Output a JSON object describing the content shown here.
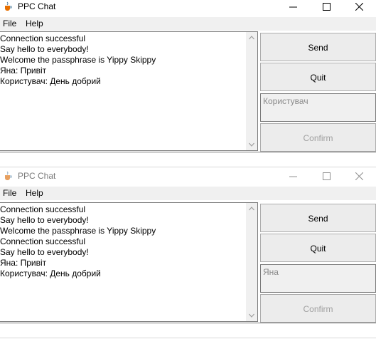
{
  "windows": [
    {
      "title": "PPC Chat",
      "menu": [
        "File",
        "Help"
      ],
      "messages": [
        "Connection successful",
        "Say hello to everybody!",
        "Welcome the passphrase is Yippy Skippy",
        "Яна: Привіт",
        "Користувач: День добрий"
      ],
      "send_label": "Send",
      "quit_label": "Quit",
      "name_value": "Користувач",
      "confirm_label": "Confirm"
    },
    {
      "title": "PPC Chat",
      "menu": [
        "File",
        "Help"
      ],
      "messages": [
        "Connection successful",
        "Say hello to everybody!",
        "Welcome the passphrase is Yippy Skippy",
        "Connection successful",
        "Say hello to everybody!",
        "Яна: Привіт",
        "Користувач: День добрий"
      ],
      "send_label": "Send",
      "quit_label": "Quit",
      "name_value": "Яна",
      "confirm_label": "Confirm"
    }
  ]
}
